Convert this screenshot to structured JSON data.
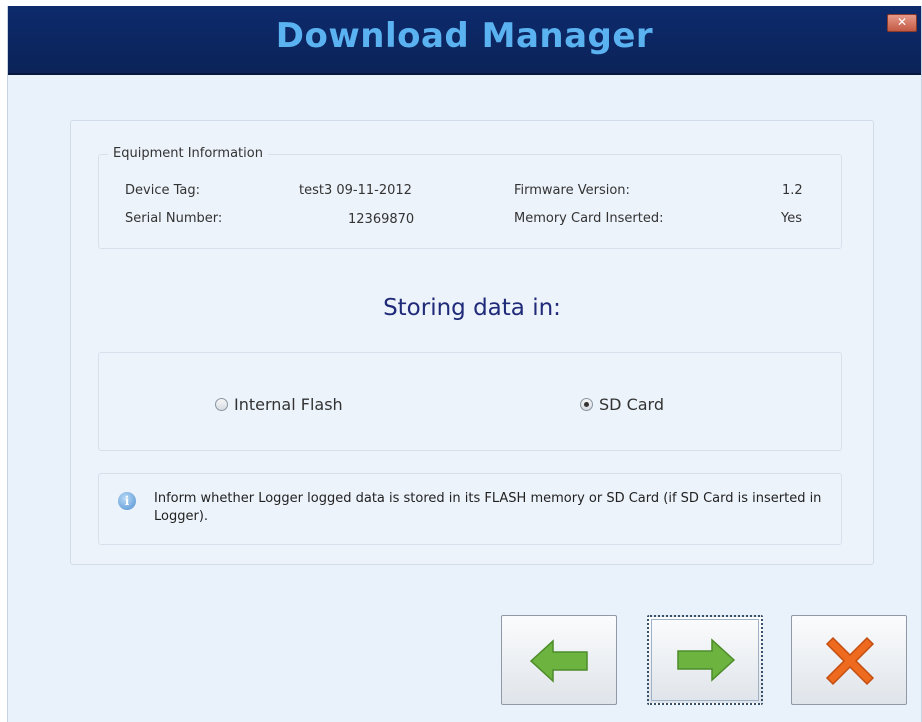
{
  "window": {
    "title": "Download Manager",
    "close_label": "✕"
  },
  "equipment": {
    "legend": "Equipment Information",
    "device_tag_label": "Device Tag:",
    "device_tag_value": "test3 09-11-2012",
    "serial_label": "Serial Number:",
    "serial_value": "12369870",
    "firmware_label": "Firmware Version:",
    "firmware_value": "1.2",
    "memory_card_label": "Memory Card Inserted:",
    "memory_card_value": "Yes"
  },
  "storage": {
    "title": "Storing data in:",
    "options": [
      {
        "label": "Internal Flash",
        "selected": false
      },
      {
        "label": "SD Card",
        "selected": true
      }
    ]
  },
  "note": {
    "text": "Inform whether Logger logged data is stored in its FLASH memory or SD Card (if SD Card is inserted in Logger)."
  },
  "buttons": {
    "back": {
      "icon": "left-arrow-icon",
      "color": "#6cb33f"
    },
    "next": {
      "icon": "right-arrow-icon",
      "color": "#6cb33f"
    },
    "cancel": {
      "icon": "cancel-x-icon",
      "color": "#ee6a1f"
    }
  }
}
